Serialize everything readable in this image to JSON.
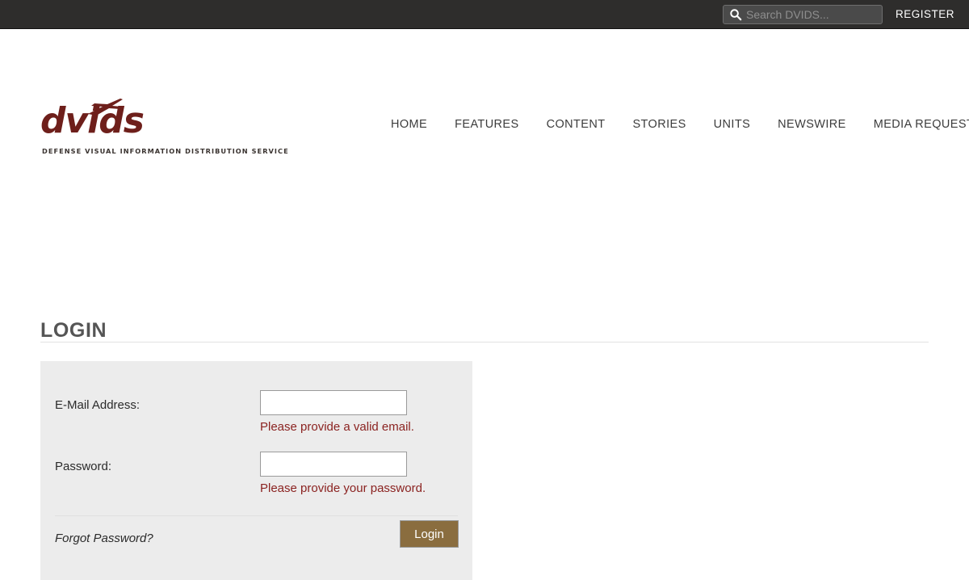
{
  "topbar": {
    "search": {
      "icon": "search-icon",
      "placeholder": "Search DVIDS...",
      "value": ""
    },
    "register_label": "REGISTER"
  },
  "header": {
    "logo": {
      "wordmark": "dvids",
      "tagline": "DEFENSE VISUAL INFORMATION DISTRIBUTION SERVICE",
      "icon": "jet-icon",
      "color": "#6e1f1b"
    },
    "nav": [
      {
        "label": "HOME"
      },
      {
        "label": "FEATURES"
      },
      {
        "label": "CONTENT"
      },
      {
        "label": "STORIES"
      },
      {
        "label": "UNITS"
      },
      {
        "label": "NEWSWIRE"
      },
      {
        "label": "MEDIA REQUESTS"
      }
    ]
  },
  "page": {
    "title": "LOGIN"
  },
  "login_form": {
    "email": {
      "label": "E-Mail Address:",
      "value": "",
      "error": "Please provide a valid email."
    },
    "password": {
      "label": "Password:",
      "value": "",
      "error": "Please provide your password."
    },
    "forgot_password_label": "Forgot Password?",
    "submit_label": "Login",
    "colors": {
      "panel_background": "#ececec",
      "error_text": "#8b2321",
      "submit_background": "#8a6d3f"
    }
  }
}
